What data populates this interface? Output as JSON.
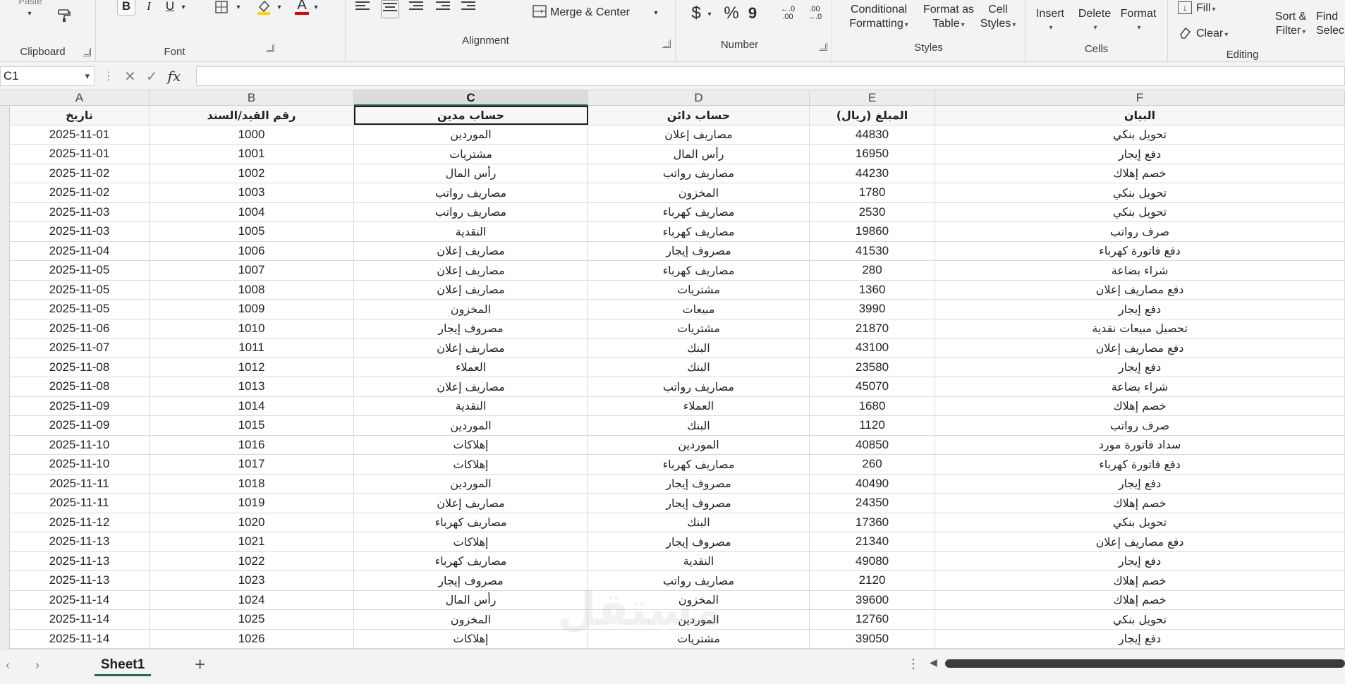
{
  "ribbon": {
    "clipboard": {
      "paste_label": "Paste",
      "group_label": "Clipboard"
    },
    "font": {
      "bold": "B",
      "italic": "I",
      "underline": "U",
      "font_color": "A",
      "group_label": "Font"
    },
    "alignment": {
      "merge_label": "Merge & Center",
      "group_label": "Alignment"
    },
    "number": {
      "currency": "$",
      "percent": "%",
      "comma": "9",
      "inc_decimal": "←.0 .00",
      "dec_decimal": ".00 →.0",
      "group_label": "Number"
    },
    "styles": {
      "conditional_line1": "Conditional",
      "conditional_line2": "Formatting",
      "format_table_line1": "Format as",
      "format_table_line2": "Table",
      "cell_styles_line1": "Cell",
      "cell_styles_line2": "Styles",
      "group_label": "Styles"
    },
    "cells": {
      "insert": "Insert",
      "delete": "Delete",
      "format": "Format",
      "group_label": "Cells"
    },
    "editing": {
      "fill": "Fill",
      "clear": "Clear",
      "sort_line1": "Sort &",
      "sort_line2": "Filter",
      "find_line1": "Find",
      "find_line2": "Selec",
      "group_label": "Editing"
    }
  },
  "formula_bar": {
    "name_box": "C1",
    "fx": "fx",
    "cancel": "✕",
    "enter": "✓",
    "formula": ""
  },
  "columns": [
    "A",
    "B",
    "C",
    "D",
    "E",
    "F"
  ],
  "selected_column": "C",
  "table": {
    "headers": [
      "تاريخ",
      "رقم القيد/السند",
      "حساب مدين",
      "حساب دائن",
      "المبلغ (ريال)",
      "البيان"
    ],
    "rows": [
      [
        "2025-11-01",
        "1000",
        "الموردين",
        "مصاريف إعلان",
        "44830",
        "تحويل بنكي"
      ],
      [
        "2025-11-01",
        "1001",
        "مشتريات",
        "رأس المال",
        "16950",
        "دفع إيجار"
      ],
      [
        "2025-11-02",
        "1002",
        "رأس المال",
        "مصاريف رواتب",
        "44230",
        "خصم إهلاك"
      ],
      [
        "2025-11-02",
        "1003",
        "مصاريف رواتب",
        "المخزون",
        "1780",
        "تحويل بنكي"
      ],
      [
        "2025-11-03",
        "1004",
        "مصاريف رواتب",
        "مصاريف كهرباء",
        "2530",
        "تحويل بنكي"
      ],
      [
        "2025-11-03",
        "1005",
        "النقدية",
        "مصاريف كهرباء",
        "19860",
        "صرف رواتب"
      ],
      [
        "2025-11-04",
        "1006",
        "مصاريف إعلان",
        "مصروف إيجار",
        "41530",
        "دفع فاتورة كهرباء"
      ],
      [
        "2025-11-05",
        "1007",
        "مصاريف إعلان",
        "مصاريف كهرباء",
        "280",
        "شراء بضاعة"
      ],
      [
        "2025-11-05",
        "1008",
        "مصاريف إعلان",
        "مشتريات",
        "1360",
        "دفع مصاريف إعلان"
      ],
      [
        "2025-11-05",
        "1009",
        "المخزون",
        "مبيعات",
        "3990",
        "دفع إيجار"
      ],
      [
        "2025-11-06",
        "1010",
        "مصروف إيجار",
        "مشتريات",
        "21870",
        "تحصيل مبيعات نقدية"
      ],
      [
        "2025-11-07",
        "1011",
        "مصاريف إعلان",
        "البنك",
        "43100",
        "دفع مصاريف إعلان"
      ],
      [
        "2025-11-08",
        "1012",
        "العملاء",
        "البنك",
        "23580",
        "دفع إيجار"
      ],
      [
        "2025-11-08",
        "1013",
        "مصاريف إعلان",
        "مصاريف رواتب",
        "45070",
        "شراء بضاعة"
      ],
      [
        "2025-11-09",
        "1014",
        "النقدية",
        "العملاء",
        "1680",
        "خصم إهلاك"
      ],
      [
        "2025-11-09",
        "1015",
        "الموردين",
        "البنك",
        "1120",
        "صرف رواتب"
      ],
      [
        "2025-11-10",
        "1016",
        "إهلاكات",
        "الموردين",
        "40850",
        "سداد فاتورة مورد"
      ],
      [
        "2025-11-10",
        "1017",
        "إهلاكات",
        "مصاريف كهرباء",
        "260",
        "دفع فاتورة كهرباء"
      ],
      [
        "2025-11-11",
        "1018",
        "الموردين",
        "مصروف إيجار",
        "40490",
        "دفع إيجار"
      ],
      [
        "2025-11-11",
        "1019",
        "مصاريف إعلان",
        "مصروف إيجار",
        "24350",
        "خصم إهلاك"
      ],
      [
        "2025-11-12",
        "1020",
        "مصاريف كهرباء",
        "البنك",
        "17360",
        "تحويل بنكي"
      ],
      [
        "2025-11-13",
        "1021",
        "إهلاكات",
        "مصروف إيجار",
        "21340",
        "دفع مصاريف إعلان"
      ],
      [
        "2025-11-13",
        "1022",
        "مصاريف كهرباء",
        "النقدية",
        "49080",
        "دفع إيجار"
      ],
      [
        "2025-11-13",
        "1023",
        "مصروف إيجار",
        "مصاريف رواتب",
        "2120",
        "خصم إهلاك"
      ],
      [
        "2025-11-14",
        "1024",
        "رأس المال",
        "المخزون",
        "39600",
        "خصم إهلاك"
      ],
      [
        "2025-11-14",
        "1025",
        "المخزون",
        "الموردين",
        "12760",
        "تحويل بنكي"
      ],
      [
        "2025-11-14",
        "1026",
        "إهلاكات",
        "مشتريات",
        "39050",
        "دفع إيجار"
      ]
    ]
  },
  "watermark": "مستقل",
  "sheet_tabs": {
    "active": "Sheet1",
    "add": "+"
  },
  "colors": {
    "accent": "#1e7145",
    "grid_line": "#dadada",
    "header_bg": "#ececec"
  }
}
